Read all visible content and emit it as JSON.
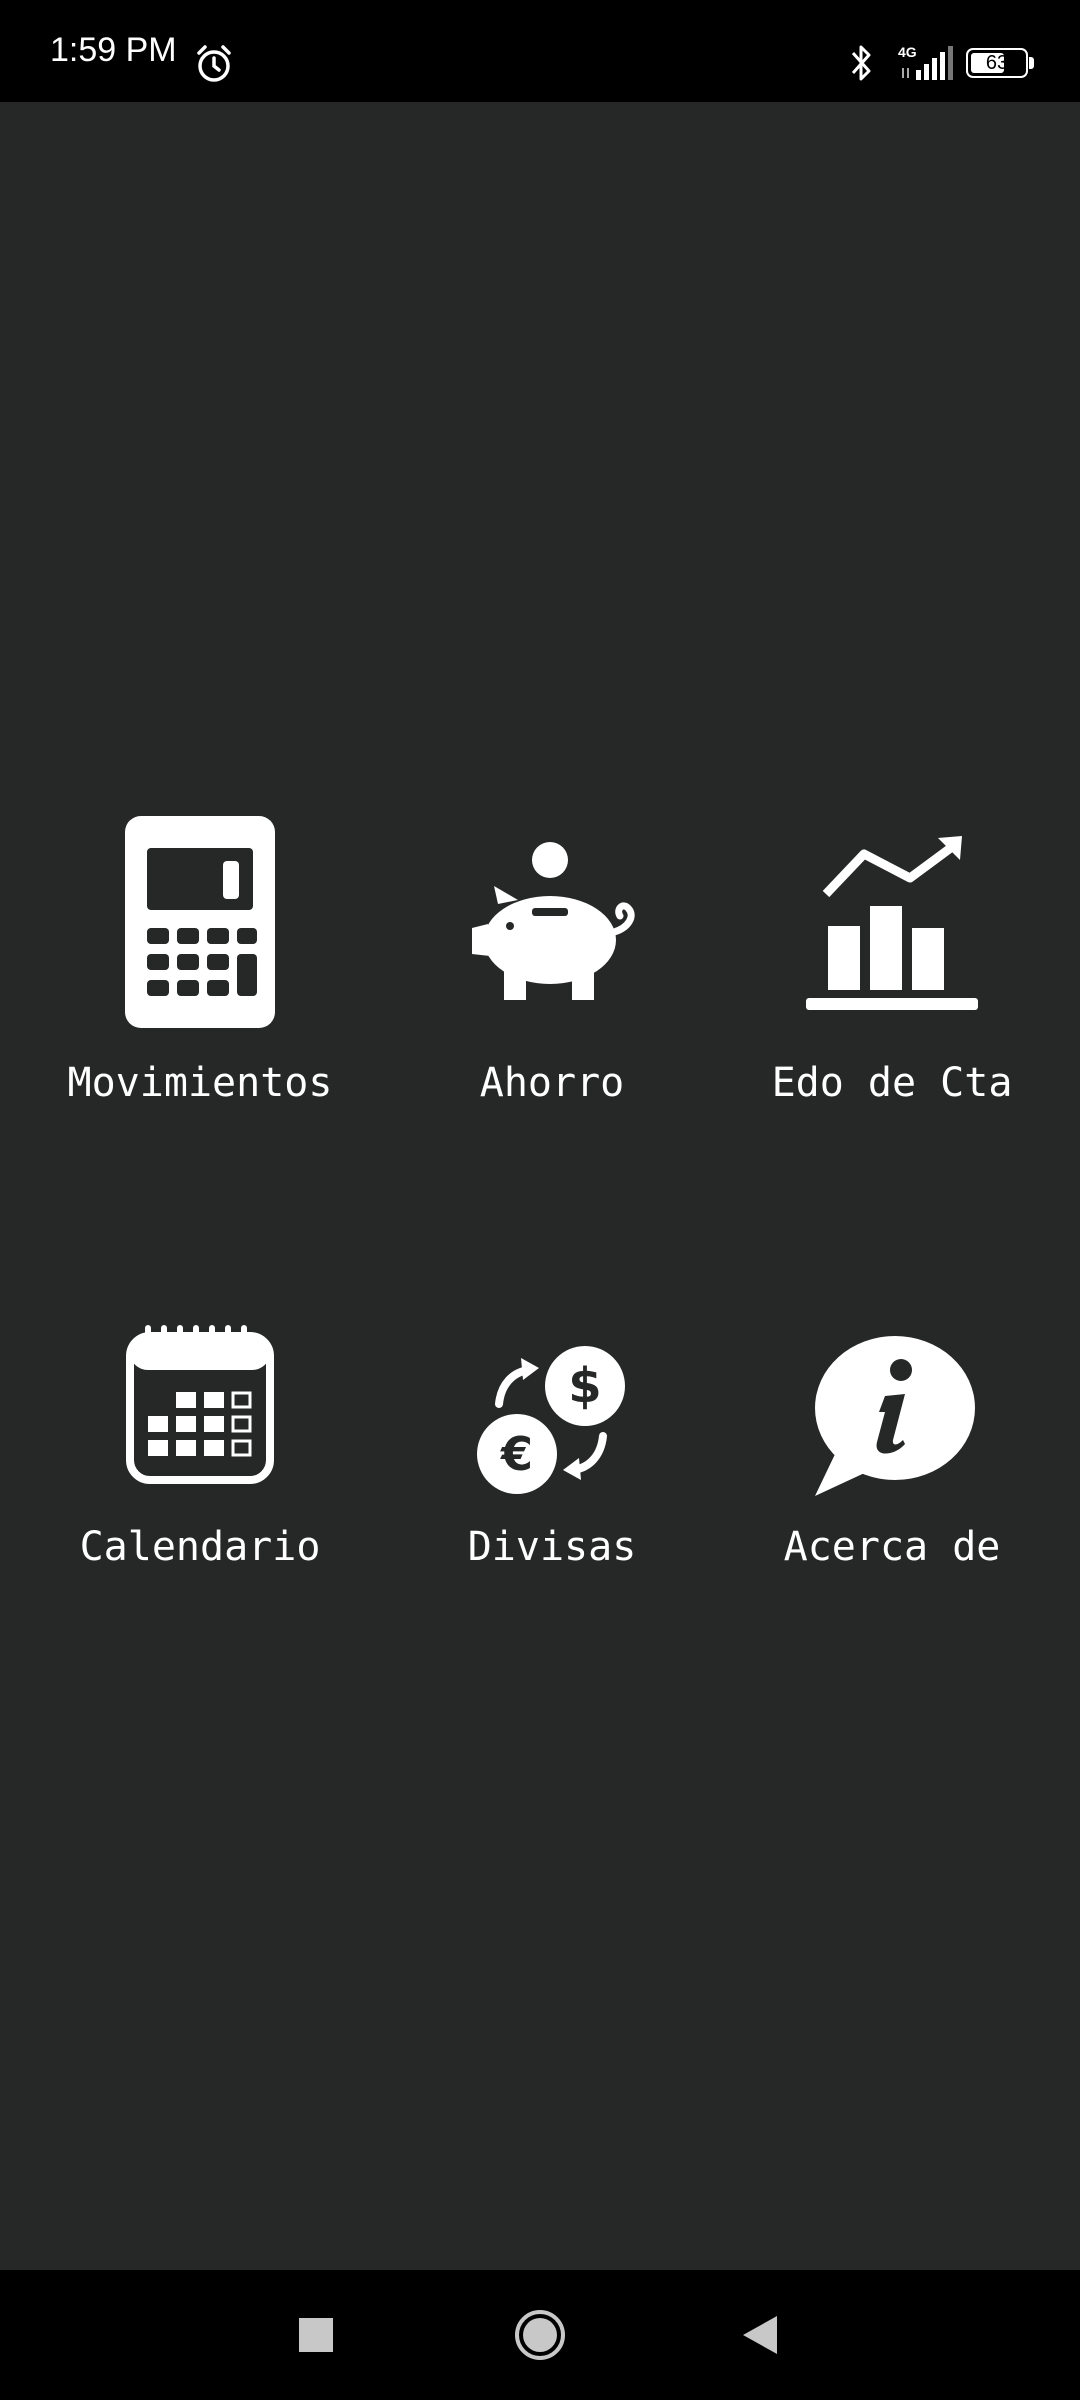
{
  "status_bar": {
    "time": "1:59 PM",
    "network": "4G",
    "battery_level": "63",
    "battery_fraction": 0.63,
    "icons": [
      "alarm-icon",
      "bluetooth-icon",
      "signal-icon",
      "battery-icon"
    ]
  },
  "menu": {
    "items": [
      {
        "label": "Movimientos",
        "icon": "calculator-icon"
      },
      {
        "label": "Ahorro",
        "icon": "piggy-bank-icon"
      },
      {
        "label": "Edo de Cta",
        "icon": "bar-chart-trend-icon"
      },
      {
        "label": "Calendario",
        "icon": "calendar-icon"
      },
      {
        "label": "Divisas",
        "icon": "currency-exchange-icon"
      },
      {
        "label": "Acerca de",
        "icon": "info-bubble-icon"
      }
    ]
  },
  "nav_bar": {
    "buttons": [
      "recents-square-icon",
      "home-circle-icon",
      "back-triangle-icon"
    ]
  },
  "colors": {
    "background": "#262727",
    "bars": "#000000",
    "foreground": "#ffffff"
  }
}
